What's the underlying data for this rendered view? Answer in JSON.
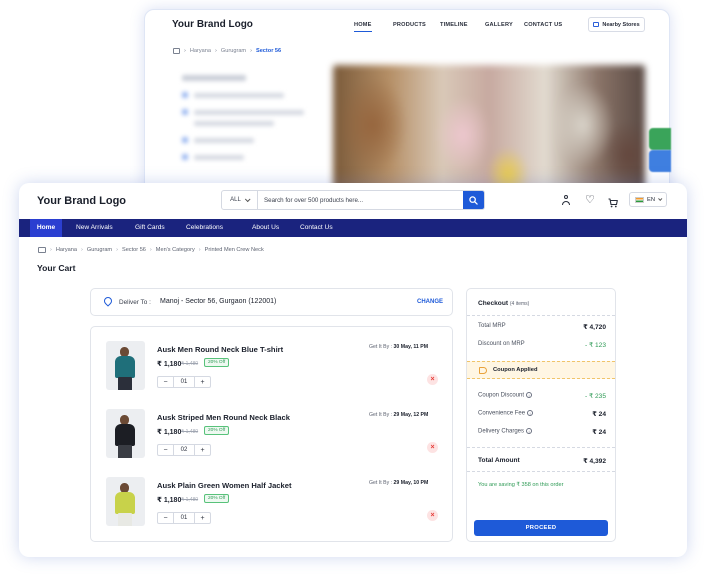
{
  "back_window": {
    "logo": "Your Brand Logo",
    "nav": [
      "HOME",
      "PRODUCTS",
      "TIMELINE",
      "GALLERY",
      "CONTACT US"
    ],
    "nearby_stores": "Nearby Stores",
    "breadcrumb": [
      "Haryana",
      "Gurugram",
      "Sector 56"
    ]
  },
  "header": {
    "logo": "Your Brand Logo",
    "search": {
      "category": "ALL",
      "placeholder": "Search for over 500 products here..."
    },
    "language": "EN"
  },
  "navbar": [
    "Home",
    "New Arrivals",
    "Gift Cards",
    "Celebrations",
    "About Us",
    "Contact Us"
  ],
  "breadcrumb": [
    "Haryana",
    "Gurugram",
    "Sector 56",
    "Men's Category",
    "Printed Men Crew Neck"
  ],
  "page_title": "Your Cart",
  "delivery": {
    "label": "Deliver To :",
    "address": "Manoj - Sector 56, Gurgaon (122001)",
    "change": "CHANGE"
  },
  "cart_items": [
    {
      "name": "Ausk Men Round Neck Blue T-shirt",
      "price": "₹ 1,180",
      "mrp": "₹ 1,480",
      "discount": "20% Off",
      "qty": "01",
      "eta_label": "Get It By :",
      "eta": "30 May, 11 PM",
      "shirt_color": "#1f6f7a",
      "pants_color": "#2b2f3a"
    },
    {
      "name": "Ausk Striped Men Round Neck Black",
      "price": "₹ 1,180",
      "mrp": "₹ 1,480",
      "discount": "20% Off",
      "qty": "02",
      "eta_label": "Get It By :",
      "eta": "29 May, 12 PM",
      "shirt_color": "#1c1e24",
      "pants_color": "#3a3d44"
    },
    {
      "name": "Ausk Plain Green Women Half Jacket",
      "price": "₹ 1,180",
      "mrp": "₹ 1,480",
      "discount": "20% Off",
      "qty": "01",
      "eta_label": "Get It By :",
      "eta": "29 May, 10 PM",
      "shirt_color": "#c8d24a",
      "pants_color": "#e8e9e4"
    }
  ],
  "checkout": {
    "title": "Checkout",
    "count": "(4 items)",
    "total_mrp_label": "Total MRP",
    "total_mrp": "₹ 4,720",
    "discount_label": "Discount on MRP",
    "discount": "- ₹ 123",
    "coupon_applied": "Coupon Applied",
    "coupon_discount_label": "Coupon Discount",
    "coupon_discount": "- ₹ 235",
    "convenience_label": "Convenience Fee",
    "convenience": "₹ 24",
    "delivery_label": "Delivery Charges",
    "delivery": "₹ 24",
    "total_label": "Total Amount",
    "total": "₹ 4,392",
    "saving": "You are saving ₹ 358 on this order",
    "proceed": "PROCEED"
  },
  "colors": {
    "primary": "#1e5ad8",
    "navbar": "#1a237e",
    "success": "#2e9a55",
    "danger": "#e53935"
  }
}
